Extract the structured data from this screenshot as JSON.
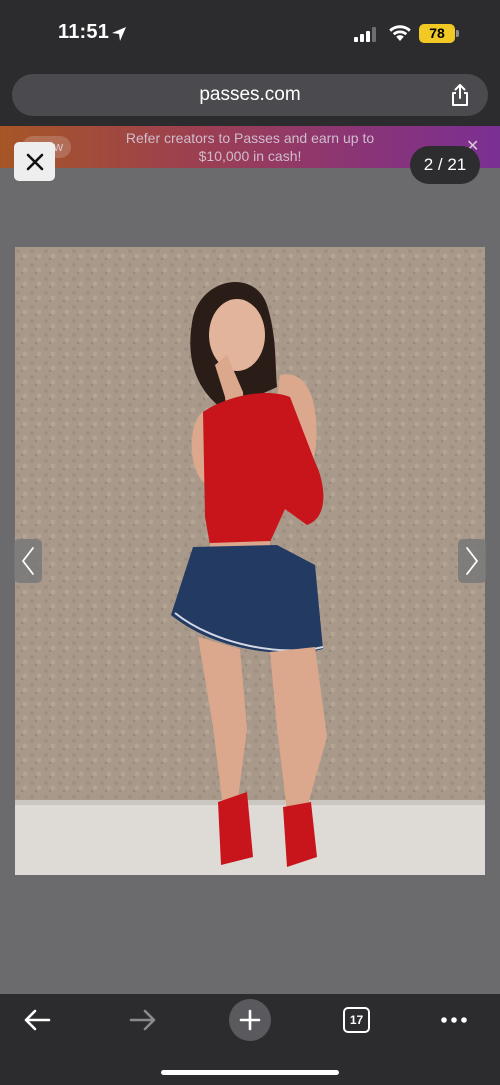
{
  "status_bar": {
    "time": "11:51",
    "battery": "78",
    "icons": [
      "location-arrow-icon",
      "signal-icon",
      "wifi-icon",
      "battery-icon"
    ],
    "battery_color": "#f2c924"
  },
  "browser": {
    "url": "passes.com",
    "share_icon": "share-icon"
  },
  "banner": {
    "pill_text": "w",
    "text": "Refer creators to Passes and earn up to $10,000 in cash!",
    "close_icon": "close-icon"
  },
  "viewer": {
    "close_icon": "close-icon",
    "counter": "2 / 21",
    "prev_icon": "chevron-left-icon",
    "next_icon": "chevron-right-icon",
    "photo": "woman in red top and denim mini skirt posing against a textured wall"
  },
  "toolbar": {
    "back_icon": "arrow-left-icon",
    "forward_icon": "arrow-right-icon",
    "new_tab_icon": "plus-icon",
    "tabs_count": "17",
    "more_icon": "ellipsis-icon"
  }
}
